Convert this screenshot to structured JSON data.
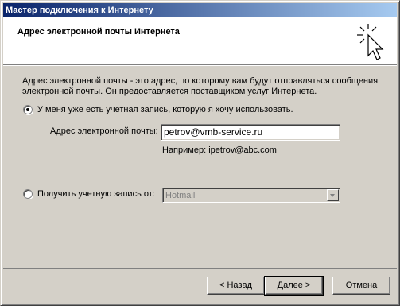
{
  "window": {
    "title": "Мастер подключения к Интернету"
  },
  "header": {
    "title": "Адрес электронной почты Интернета",
    "icon": "wizard-sparkle-cursor-icon"
  },
  "body": {
    "description": "Адрес электронной почты - это адрес, по которому вам будут отправляться сообщения электронной почты. Он предоставляется поставщиком услуг Интернета.",
    "option_existing": {
      "label": "У меня уже есть учетная запись, которую я хочу использовать.",
      "checked": true,
      "email_label": "Адрес электронной почты:",
      "email_value": "petrov@vmb-service.ru",
      "example": "Например: ipetrov@abc.com"
    },
    "option_new": {
      "label": "Получить учетную запись от:",
      "checked": false,
      "provider_selected": "Hotmail"
    }
  },
  "buttons": {
    "back": "< Назад",
    "next": "Далее >",
    "cancel": "Отмена"
  }
}
